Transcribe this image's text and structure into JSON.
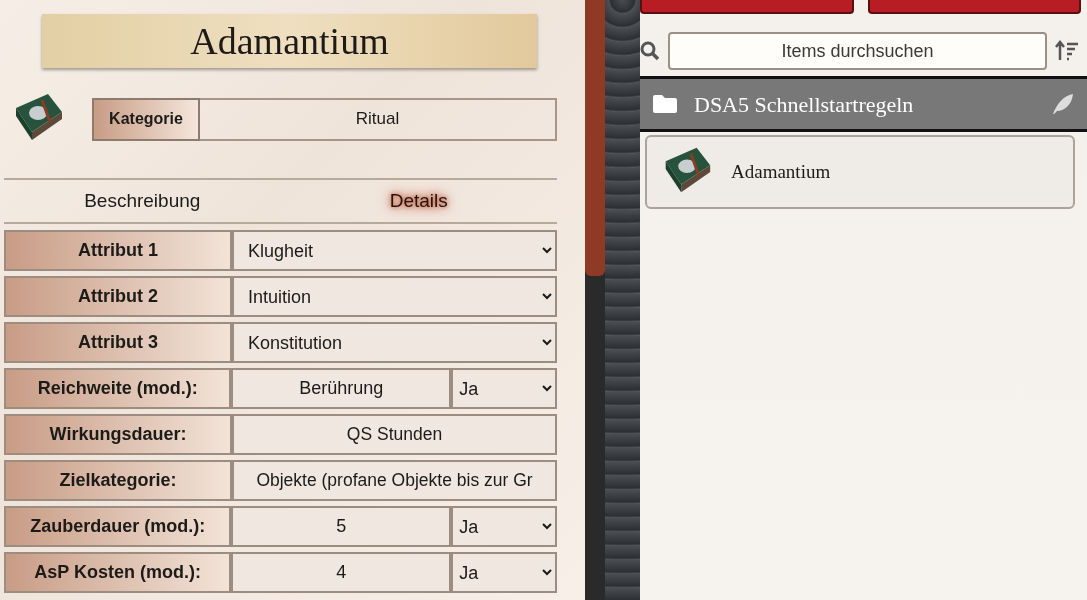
{
  "item": {
    "name": "Adamantium",
    "category_label": "Kategorie",
    "category": "Ritual"
  },
  "tabs": [
    {
      "label": "Beschreibung",
      "selected": false
    },
    {
      "label": "Details",
      "selected": true
    }
  ],
  "fields": [
    {
      "kind": "select",
      "label": "Attribut 1",
      "value": "Klugheit"
    },
    {
      "kind": "select",
      "label": "Attribut 2",
      "value": "Intuition"
    },
    {
      "kind": "select",
      "label": "Attribut 3",
      "value": "Konstitution"
    },
    {
      "kind": "text_mod",
      "label": "Reichweite (mod.):",
      "value": "Berührung",
      "mod": "Ja"
    },
    {
      "kind": "text",
      "label": "Wirkungsdauer:",
      "value": "QS Stunden"
    },
    {
      "kind": "text",
      "label": "Zielkategorie:",
      "value": "Objekte (profane Objekte bis zur Gr"
    },
    {
      "kind": "text_mod",
      "label": "Zauberdauer (mod.):",
      "value": "5",
      "mod": "Ja"
    },
    {
      "kind": "text_mod",
      "label": "AsP Kosten (mod.):",
      "value": "4",
      "mod": "Ja"
    }
  ],
  "sidebar": {
    "search": {
      "placeholder": "Items durchsuchen"
    },
    "folders": [
      {
        "name": "DSA5 Schnellstartregeln",
        "items": [
          {
            "name": "Adamantium"
          }
        ]
      }
    ]
  }
}
